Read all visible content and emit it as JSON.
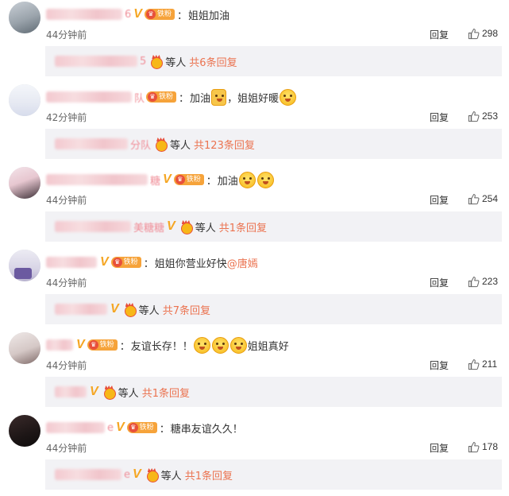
{
  "ui": {
    "reply_label": "回复",
    "etc_label": "等人"
  },
  "comments": [
    {
      "name_fragment": "6",
      "badge_label": "铁粉",
      "text": "姐姐加油",
      "mention": "",
      "time": "44分钟前",
      "likes": "298",
      "sub_fragment": "5",
      "sub_count": "共6条回复"
    },
    {
      "name_fragment": "队",
      "badge_label": "铁粉",
      "text": "加油",
      "text_after": "，姐姐好暖",
      "mention": "",
      "time": "42分钟前",
      "likes": "253",
      "sub_fragment": "分队",
      "sub_count": "共123条回复"
    },
    {
      "name_fragment": "糖",
      "badge_label": "铁粉",
      "text": "加油",
      "mention": "",
      "time": "44分钟前",
      "likes": "254",
      "sub_fragment": "美糖糖",
      "sub_count": "共1条回复"
    },
    {
      "name_fragment": "",
      "badge_label": "铁粉",
      "text": "姐姐你营业好快",
      "mention": "@唐嫣",
      "time": "44分钟前",
      "likes": "223",
      "sub_fragment": "",
      "sub_count": "共7条回复"
    },
    {
      "name_fragment": "",
      "badge_label": "铁粉",
      "text": "友谊长存！！",
      "text_after": "姐姐真好",
      "mention": "",
      "time": "44分钟前",
      "likes": "211",
      "sub_fragment": "",
      "sub_count": "共1条回复"
    },
    {
      "name_fragment": "e",
      "badge_label": "铁粉",
      "text": "糖串友谊久久！",
      "mention": "",
      "time": "44分钟前",
      "likes": "178",
      "sub_fragment": "e",
      "sub_count": "共1条回复"
    }
  ]
}
